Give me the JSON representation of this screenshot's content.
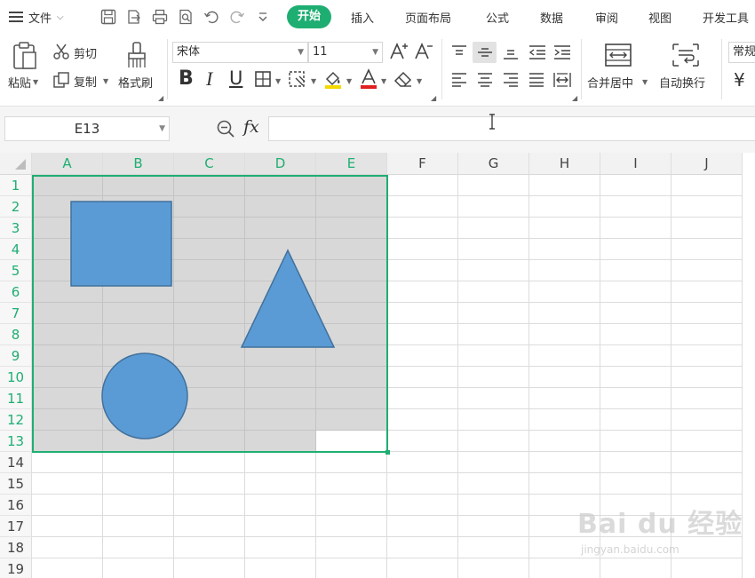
{
  "menubar": {
    "file_label": "文件",
    "tabs": [
      "开始",
      "插入",
      "页面布局",
      "公式",
      "数据",
      "审阅",
      "视图",
      "开发工具"
    ]
  },
  "ribbon": {
    "paste_label": "粘贴",
    "cut_label": "剪切",
    "copy_label": "复制",
    "format_painter_label": "格式刷",
    "font_name": "宋体",
    "font_size": "11",
    "bold_label": "B",
    "italic_label": "I",
    "underline_label": "U",
    "merge_center_label": "合并居中",
    "wrap_text_label": "自动换行",
    "number_format": "常规",
    "currency_symbol": "¥"
  },
  "formula_bar": {
    "name_box": "E13",
    "fx_label": "fx",
    "formula": ""
  },
  "grid": {
    "columns": [
      "A",
      "B",
      "C",
      "D",
      "E",
      "F",
      "G",
      "H",
      "I",
      "J"
    ],
    "rows": [
      "1",
      "2",
      "3",
      "4",
      "5",
      "6",
      "7",
      "8",
      "9",
      "10",
      "11",
      "12",
      "13",
      "14",
      "15",
      "16",
      "17",
      "18",
      "19"
    ],
    "selected_range": "A1:E13",
    "active_cell": "E13"
  },
  "shapes": [
    {
      "kind": "rectangle",
      "fill": "#5b9bd5",
      "stroke": "#41719c"
    },
    {
      "kind": "triangle",
      "fill": "#5b9bd5",
      "stroke": "#41719c"
    },
    {
      "kind": "circle",
      "fill": "#5b9bd5",
      "stroke": "#41719c"
    }
  ],
  "colors": {
    "accent": "#1fae72",
    "selection_fill": "#d8d8d8",
    "shape_fill": "#5b9bd5",
    "font_color_bar": "#e02020",
    "highlight_bar": "#f5d800"
  },
  "watermark": {
    "main": "Bai du 经验",
    "sub": "jingyan.baidu.com"
  }
}
